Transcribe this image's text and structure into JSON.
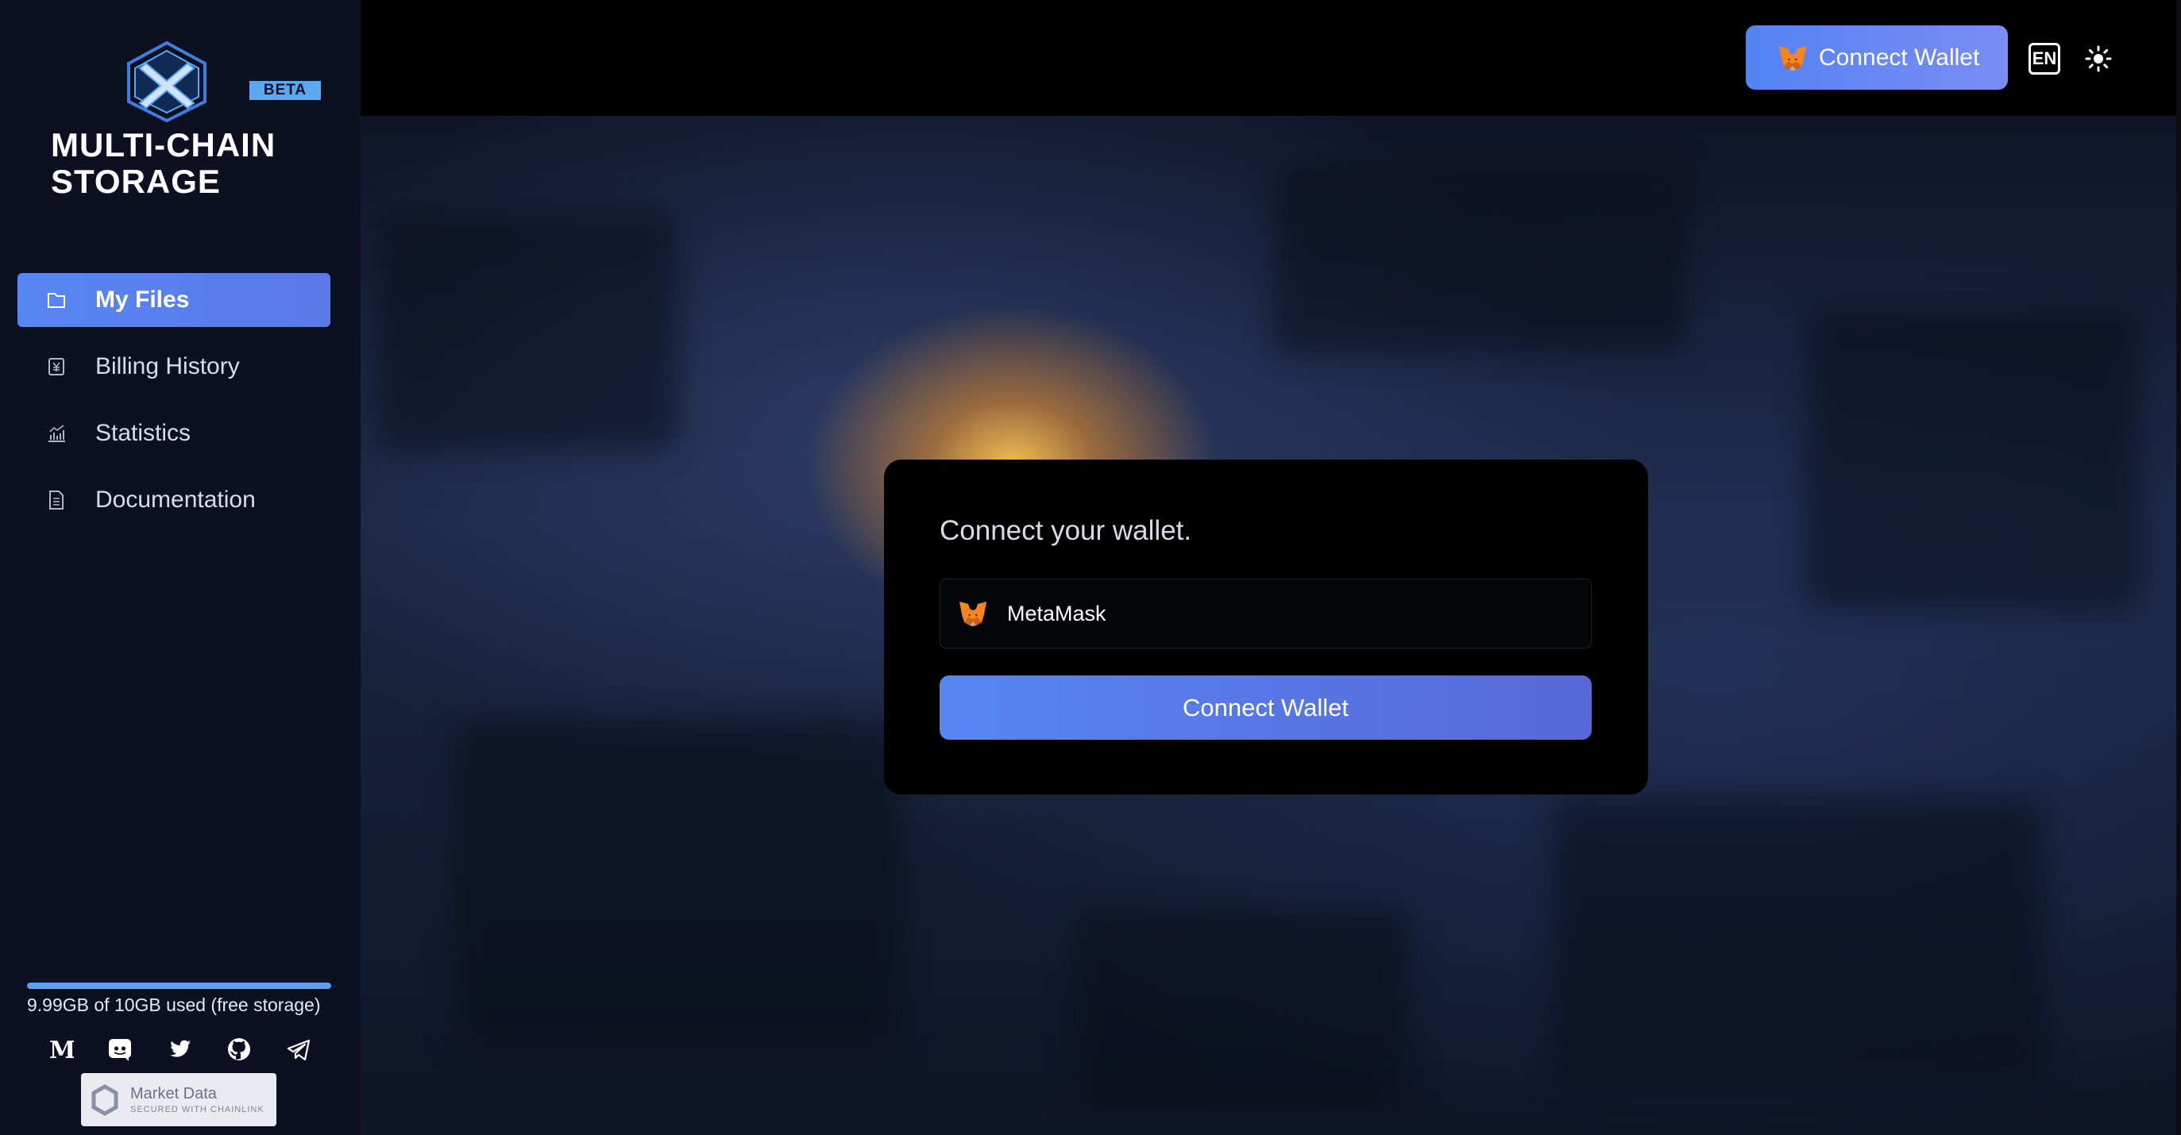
{
  "brand": {
    "title": "MULTI-CHAIN\nSTORAGE",
    "badge": "BETA",
    "logo_icon": "x-hexagon-logo"
  },
  "sidebar": {
    "items": [
      {
        "label": "My Files",
        "icon": "folder-icon",
        "active": true
      },
      {
        "label": "Billing History",
        "icon": "receipt-icon",
        "active": false
      },
      {
        "label": "Statistics",
        "icon": "bar-chart-icon",
        "active": false
      },
      {
        "label": "Documentation",
        "icon": "document-icon",
        "active": false
      }
    ],
    "storage": {
      "text": "9.99GB of 10GB used (free storage)",
      "used_fraction": 0.999
    },
    "socials": [
      "medium-icon",
      "discord-icon",
      "twitter-icon",
      "github-icon",
      "telegram-icon"
    ],
    "chainlink_badge": {
      "title": "Market Data",
      "subtitle": "SECURED WITH CHAINLINK"
    }
  },
  "topbar": {
    "connect_label": "Connect Wallet",
    "language": "EN",
    "theme_icon": "sun-icon"
  },
  "modal": {
    "title": "Connect your wallet.",
    "wallet_option": "MetaMask",
    "connect_label": "Connect Wallet"
  },
  "colors": {
    "accent": "#5686f3",
    "sidebar_bg": "#0c1020",
    "badge": "#5aa8f0"
  }
}
